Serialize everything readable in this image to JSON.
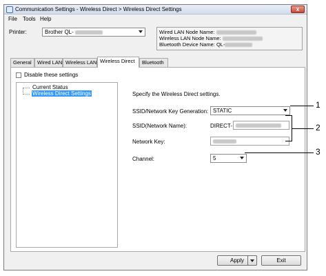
{
  "window": {
    "title": "Communication Settings - Wireless Direct > Wireless Direct Settings",
    "close_glyph": "x"
  },
  "menu": [
    "File",
    "Tools",
    "Help"
  ],
  "printer": {
    "label": "Printer:",
    "value": "Brother QL-"
  },
  "node_info": {
    "wired_lan_node_name": "Wired LAN Node Name:",
    "wireless_lan_node_name": "Wireless LAN Node Name:",
    "bluetooth_device_name": "Bluetooth Device Name: QL-"
  },
  "tabs": [
    "General",
    "Wired LAN",
    "Wireless LAN",
    "Wireless Direct",
    "Bluetooth"
  ],
  "active_tab": "Wireless Direct",
  "disable_settings": {
    "label": "Disable these settings",
    "checked": false
  },
  "tree": {
    "items": [
      "Current Status",
      "Wireless Direct Settings"
    ],
    "selected": "Wireless Direct Settings"
  },
  "content": {
    "description": "Specify the Wireless Direct settings.",
    "ssid_key_generation": {
      "label": "SSID/Network Key Generation:",
      "value": "STATIC"
    },
    "ssid": {
      "label": "SSID(Network Name):",
      "prefix": "DIRECT-"
    },
    "network_key": {
      "label": "Network Key:"
    },
    "channel": {
      "label": "Channel:",
      "value": "5"
    }
  },
  "buttons": {
    "apply": "Apply",
    "exit": "Exit"
  },
  "callouts": [
    "1",
    "2",
    "3"
  ]
}
